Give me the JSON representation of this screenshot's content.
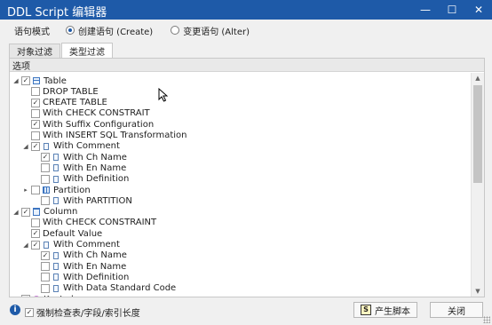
{
  "window": {
    "title": "DDL Script 编辑器",
    "controls": {
      "minimize": "—",
      "maximize": "☐",
      "close": "✕"
    }
  },
  "mode": {
    "label": "语句模式",
    "options": [
      {
        "label": "创建语句  (Create)",
        "selected": true
      },
      {
        "label": "变更语句  (Alter)",
        "selected": false
      }
    ]
  },
  "tabs": [
    {
      "label": "对象过滤",
      "active": false
    },
    {
      "label": "类型过滤",
      "active": true
    }
  ],
  "tree": {
    "header": "选项",
    "rows": [
      {
        "label": "Table",
        "level": 0,
        "expander": "◢",
        "checked": true,
        "icon": "table-icon"
      },
      {
        "label": "DROP TABLE",
        "level": 1,
        "expander": "",
        "checked": false,
        "icon": ""
      },
      {
        "label": "CREATE TABLE",
        "level": 1,
        "expander": "",
        "checked": true,
        "icon": ""
      },
      {
        "label": "With CHECK CONSTRAIT",
        "level": 1,
        "expander": "",
        "checked": false,
        "icon": ""
      },
      {
        "label": "With Suffix Configuration",
        "level": 1,
        "expander": "",
        "checked": true,
        "icon": ""
      },
      {
        "label": "With INSERT SQL Transformation",
        "level": 1,
        "expander": "",
        "checked": false,
        "icon": ""
      },
      {
        "label": "With Comment",
        "level": 1,
        "expander": "◢",
        "checked": true,
        "icon": "comment-icon"
      },
      {
        "label": "With Ch Name",
        "level": 2,
        "expander": "",
        "checked": true,
        "icon": "comment-icon"
      },
      {
        "label": "With En Name",
        "level": 2,
        "expander": "",
        "checked": false,
        "icon": "comment-icon"
      },
      {
        "label": "With Definition",
        "level": 2,
        "expander": "",
        "checked": false,
        "icon": "comment-icon"
      },
      {
        "label": "Partition",
        "level": 1,
        "expander": "▸",
        "checked": false,
        "icon": "partition-icon"
      },
      {
        "label": "With PARTITION",
        "level": 2,
        "expander": "",
        "checked": false,
        "icon": "comment-icon"
      },
      {
        "label": "Column",
        "level": 0,
        "expander": "◢",
        "checked": true,
        "icon": "column-icon"
      },
      {
        "label": "With CHECK CONSTRAINT",
        "level": 1,
        "expander": "",
        "checked": false,
        "icon": ""
      },
      {
        "label": "Default Value",
        "level": 1,
        "expander": "",
        "checked": true,
        "icon": ""
      },
      {
        "label": "With Comment",
        "level": 1,
        "expander": "◢",
        "checked": true,
        "icon": "comment-icon"
      },
      {
        "label": "With Ch Name",
        "level": 2,
        "expander": "",
        "checked": true,
        "icon": "comment-icon"
      },
      {
        "label": "With En Name",
        "level": 2,
        "expander": "",
        "checked": false,
        "icon": "comment-icon"
      },
      {
        "label": "With Definition",
        "level": 2,
        "expander": "",
        "checked": false,
        "icon": "comment-icon"
      },
      {
        "label": "With Data Standard Code",
        "level": 2,
        "expander": "",
        "checked": false,
        "icon": "comment-icon"
      },
      {
        "label": "KeyIndex",
        "level": 0,
        "expander": "▸",
        "checked": true,
        "icon": "key-icon"
      }
    ],
    "scroll": {
      "up": "▲",
      "down": "▼"
    }
  },
  "footer": {
    "info": "i",
    "enforce_label": "强制检查表/字段/索引长度",
    "enforce_checked": true,
    "generate_icon": "S",
    "generate_label": "产生脚本",
    "close_label": "关闭"
  }
}
